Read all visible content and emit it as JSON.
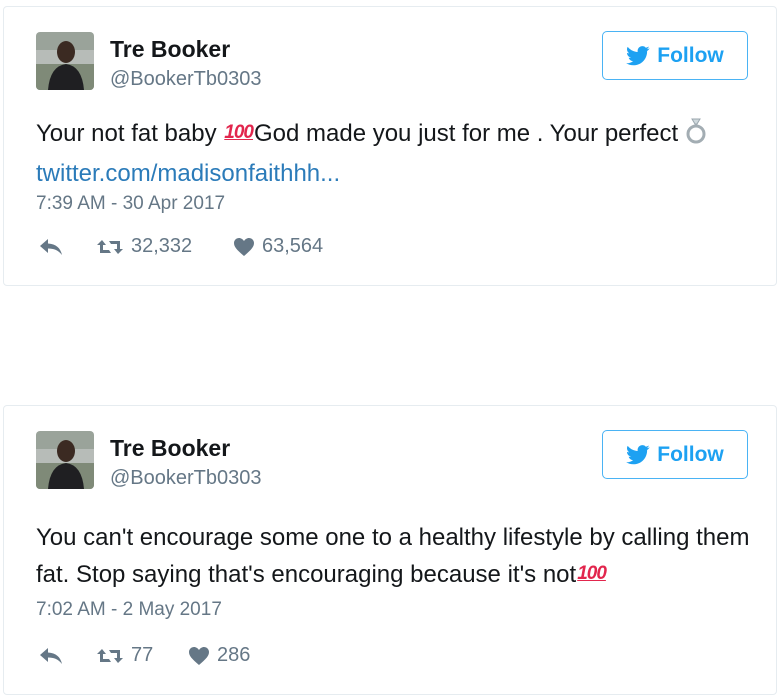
{
  "tweets": [
    {
      "name": "Tre Booker",
      "handle": "@BookerTb0303",
      "follow_label": "Follow",
      "text_part1": "Your not fat baby ",
      "emoji_100": "100",
      "text_part2": "God made you just for me . Your perfect",
      "link": "twitter.com/madisonfaithhh...",
      "timestamp": "7:39 AM - 30 Apr 2017",
      "retweets": "32,332",
      "likes": "63,564",
      "icons": [
        "reply-icon",
        "retweet-icon",
        "heart-icon",
        "ring-icon"
      ]
    },
    {
      "name": "Tre Booker",
      "handle": "@BookerTb0303",
      "follow_label": "Follow",
      "text_part1": "You can't encourage some one to a healthy lifestyle by calling them fat. Stop saying that's encouraging because it's not",
      "emoji_100": "100",
      "timestamp": "7:02 AM - 2 May 2017",
      "retweets": "77",
      "likes": "286",
      "icons": [
        "reply-icon",
        "retweet-icon",
        "heart-icon"
      ]
    }
  ],
  "colors": {
    "follow_blue": "#1da1f2",
    "link_blue": "#2b7bb9",
    "muted_gray": "#657786",
    "emoji_red": "#e2264d"
  }
}
